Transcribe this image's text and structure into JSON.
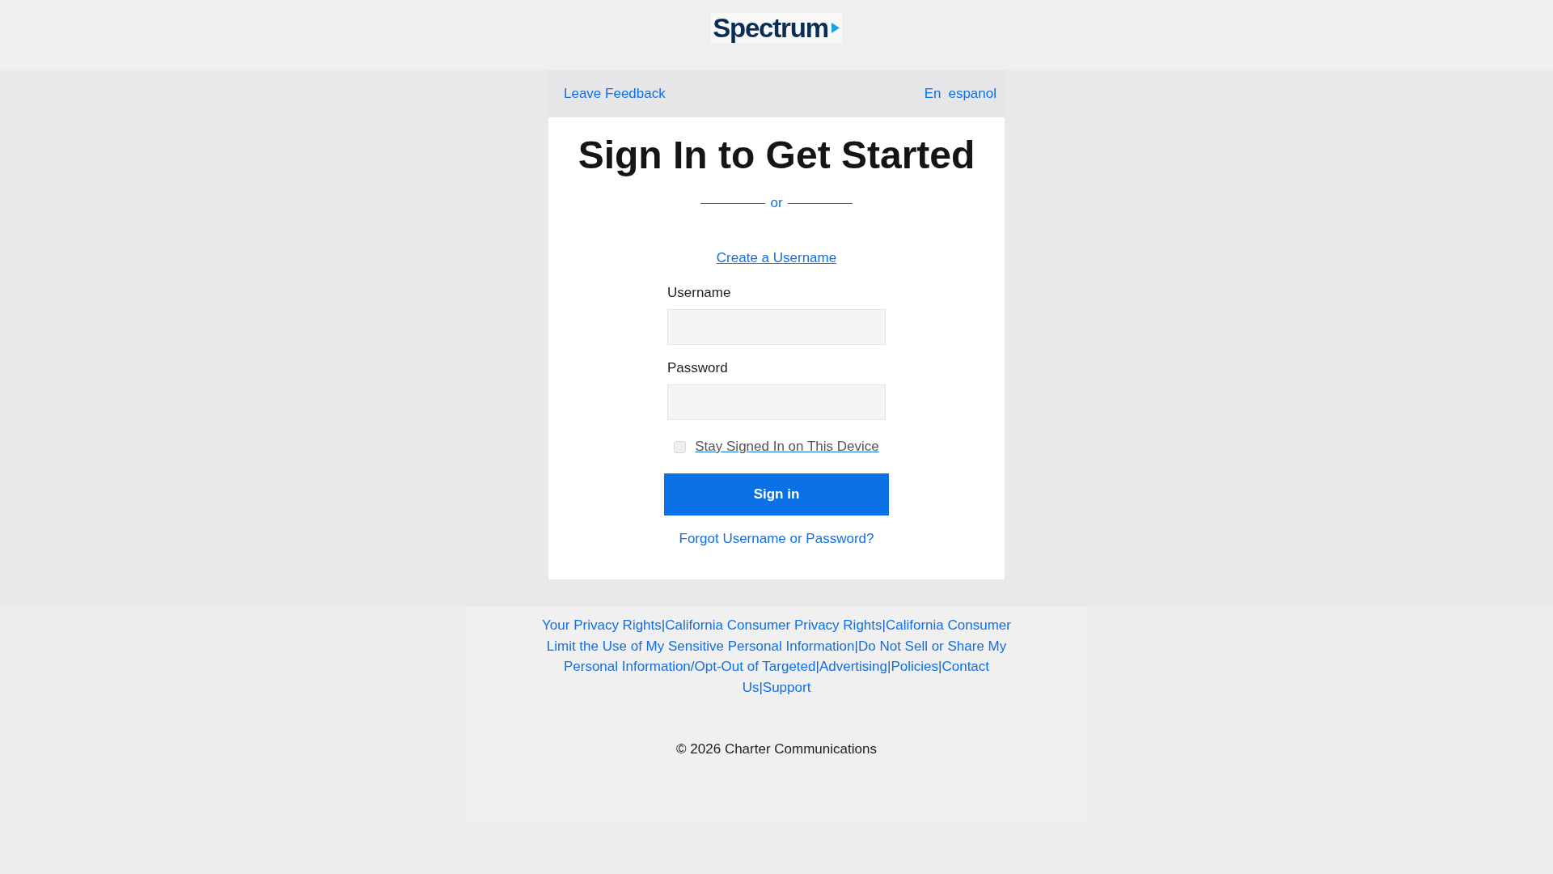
{
  "header": {
    "logo_text": "Spectrum"
  },
  "top_bar": {
    "feedback_link": "Leave Feedback",
    "languages": [
      "En",
      "espanol"
    ]
  },
  "card": {
    "title": "Sign In to Get Started",
    "divider_text": "or",
    "create_link": "Create a Username",
    "fields": [
      {
        "label": "Username"
      },
      {
        "label": "Password"
      }
    ],
    "remember": {
      "label": "Stay Signed In on This Device",
      "checked": false
    },
    "submit": "Sign in",
    "forgot_link": "Forgot Username or Password?"
  },
  "footer": {
    "link_rows": [
      [
        {
          "kind": "link",
          "text": "Your Privacy Rights"
        },
        {
          "kind": "separator",
          "text": "|"
        },
        {
          "kind": "link",
          "text": "California Consumer Privacy Rights"
        },
        {
          "kind": "separator",
          "text": "|"
        },
        {
          "kind": "link",
          "text": "California Consumer"
        }
      ],
      [
        {
          "kind": "link",
          "text": "Limit the Use of My Sensitive Personal Information"
        },
        {
          "kind": "separator",
          "text": "|"
        },
        {
          "kind": "link",
          "text": "Do Not Sell or Share My"
        }
      ],
      [
        {
          "kind": "link",
          "text": "Personal Information/Opt-Out of Targeted"
        },
        {
          "kind": "separator",
          "text": "|"
        },
        {
          "kind": "link",
          "text": "Advertising"
        },
        {
          "kind": "separator",
          "text": "|"
        },
        {
          "kind": "link",
          "text": "Policies"
        },
        {
          "kind": "separator",
          "text": "|"
        },
        {
          "kind": "link",
          "text": "Contact"
        }
      ],
      [
        {
          "kind": "link",
          "text": "Us"
        },
        {
          "kind": "separator",
          "text": "|"
        },
        {
          "kind": "link",
          "text": "Support"
        }
      ]
    ],
    "copyright": "© 2026 Charter Communications"
  }
}
